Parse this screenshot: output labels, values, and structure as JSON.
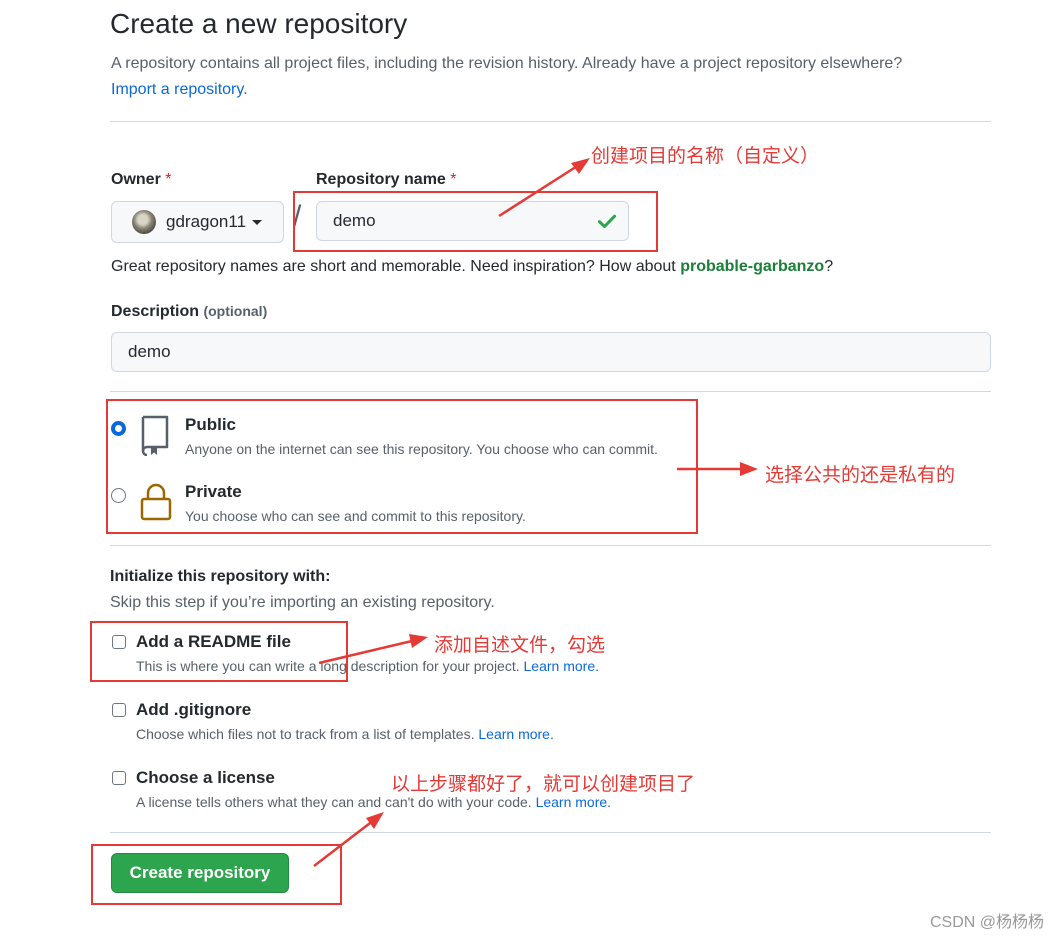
{
  "header": {
    "title": "Create a new repository",
    "intro": "A repository contains all project files, including the revision history. Already have a project repository elsewhere?",
    "import_link": "Import a repository."
  },
  "owner": {
    "label": "Owner",
    "required_mark": "*",
    "value": "gdragon11"
  },
  "separator": "/",
  "repo_name": {
    "label": "Repository name",
    "required_mark": "*",
    "value": "demo",
    "status_icon": "check-icon"
  },
  "name_hint": {
    "text": "Great repository names are short and memorable. Need inspiration? How about",
    "suggestion": "probable-garbanzo",
    "suffix": "?"
  },
  "description": {
    "label": "Description",
    "optional": "(optional)",
    "value": "demo"
  },
  "visibility": {
    "selected": "public",
    "public": {
      "title": "Public",
      "desc": "Anyone on the internet can see this repository. You choose who can commit.",
      "icon": "repo-book-icon"
    },
    "private": {
      "title": "Private",
      "desc": "You choose who can see and commit to this repository.",
      "icon": "lock-icon"
    }
  },
  "init": {
    "title": "Initialize this repository with:",
    "subtitle": "Skip this step if you’re importing an existing repository.",
    "options": [
      {
        "title": "Add a README file",
        "desc": "This is where you can write a long description for your project.",
        "link": "Learn more."
      },
      {
        "title": "Add .gitignore",
        "desc": "Choose which files not to track from a list of templates.",
        "link": "Learn more."
      },
      {
        "title": "Choose a license",
        "desc": "A license tells others what they can and can't do with your code.",
        "link": "Learn more."
      }
    ]
  },
  "submit": {
    "label": "Create repository"
  },
  "annotations": {
    "name": "创建项目的名称（自定义）",
    "visibility": "选择公共的还是私有的",
    "readme": "添加自述文件，勾选",
    "create": "以上步骤都好了，就可以创建项目了"
  },
  "watermark": "CSDN @杨杨杨",
  "colors": {
    "annotation_red": "#e53935",
    "primary_button": "#2da44e",
    "link_blue": "#0969da",
    "success_green": "#1a7f37"
  }
}
